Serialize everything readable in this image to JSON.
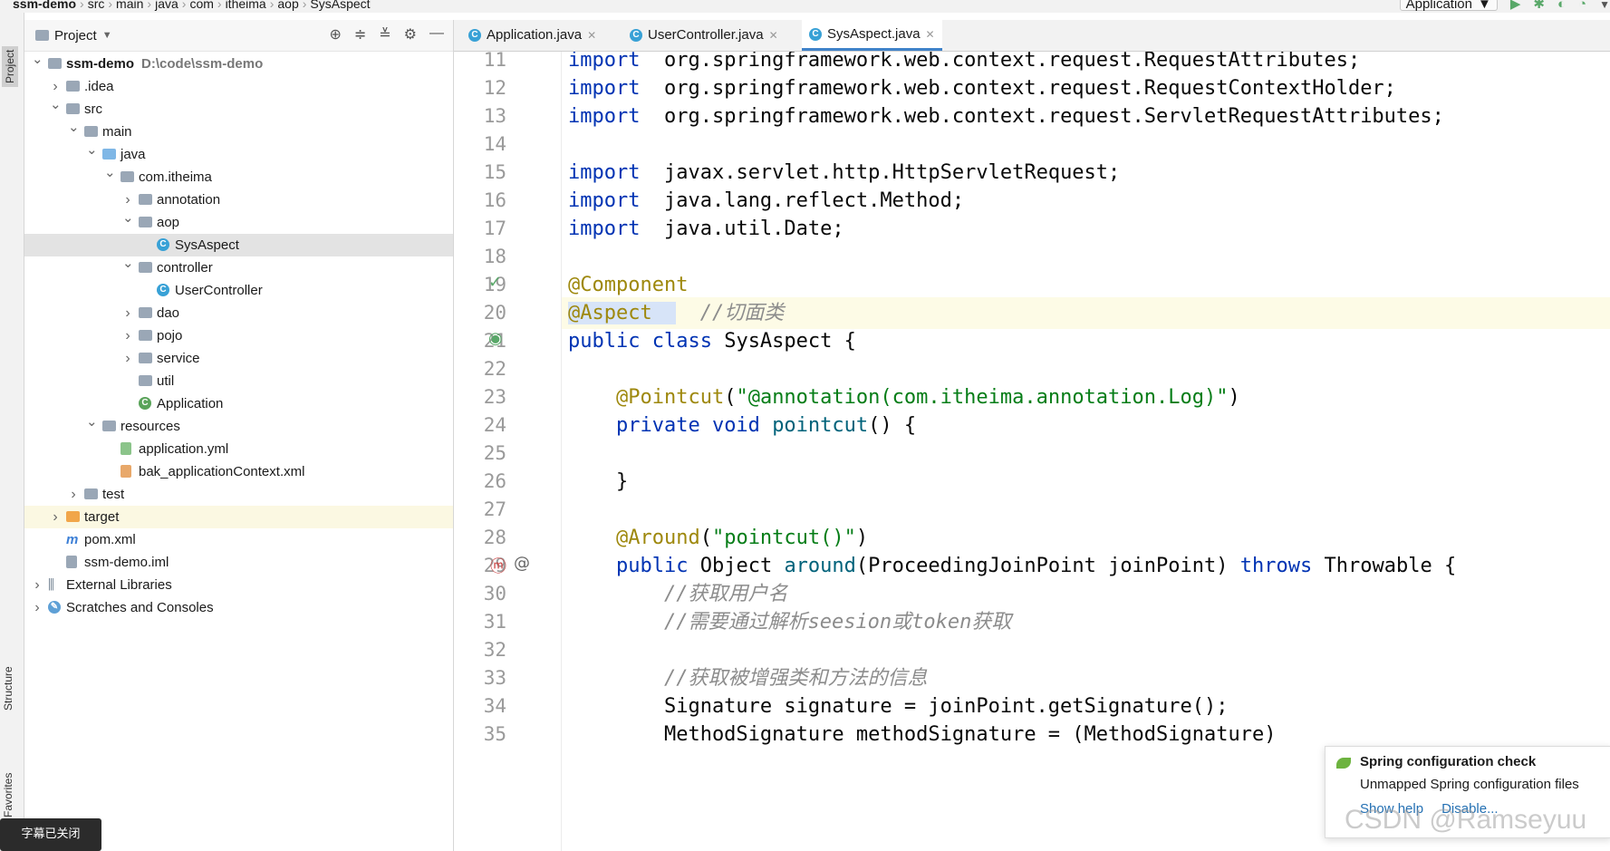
{
  "breadcrumb": [
    "ssm-demo",
    "src",
    "main",
    "java",
    "com",
    "itheima",
    "aop",
    "SysAspect"
  ],
  "run_config": {
    "label": "Application"
  },
  "left_strip": {
    "project": "Project",
    "structure": "Structure",
    "favorites": "Favorites"
  },
  "project_panel": {
    "title": "Project",
    "tree": [
      {
        "label": "ssm-demo",
        "path": "D:\\code\\ssm-demo",
        "depth": 0,
        "arrow": "open",
        "icon": "module"
      },
      {
        "label": ".idea",
        "depth": 1,
        "arrow": "closed",
        "icon": "folder"
      },
      {
        "label": "src",
        "depth": 1,
        "arrow": "open",
        "icon": "folder"
      },
      {
        "label": "main",
        "depth": 2,
        "arrow": "open",
        "icon": "folder"
      },
      {
        "label": "java",
        "depth": 3,
        "arrow": "open",
        "icon": "folder-blue"
      },
      {
        "label": "com.itheima",
        "depth": 4,
        "arrow": "open",
        "icon": "folder"
      },
      {
        "label": "annotation",
        "depth": 5,
        "arrow": "closed",
        "icon": "folder"
      },
      {
        "label": "aop",
        "depth": 5,
        "arrow": "open",
        "icon": "folder"
      },
      {
        "label": "SysAspect",
        "depth": 6,
        "arrow": "none",
        "icon": "class",
        "selected": true
      },
      {
        "label": "controller",
        "depth": 5,
        "arrow": "open",
        "icon": "folder"
      },
      {
        "label": "UserController",
        "depth": 6,
        "arrow": "none",
        "icon": "class"
      },
      {
        "label": "dao",
        "depth": 5,
        "arrow": "closed",
        "icon": "folder"
      },
      {
        "label": "pojo",
        "depth": 5,
        "arrow": "closed",
        "icon": "folder"
      },
      {
        "label": "service",
        "depth": 5,
        "arrow": "closed",
        "icon": "folder"
      },
      {
        "label": "util",
        "depth": 5,
        "arrow": "none",
        "icon": "folder"
      },
      {
        "label": "Application",
        "depth": 5,
        "arrow": "none",
        "icon": "spring-class"
      },
      {
        "label": "resources",
        "depth": 3,
        "arrow": "open",
        "icon": "folder-res"
      },
      {
        "label": "application.yml",
        "depth": 4,
        "arrow": "none",
        "icon": "yml"
      },
      {
        "label": "bak_applicationContext.xml",
        "depth": 4,
        "arrow": "none",
        "icon": "xml"
      },
      {
        "label": "test",
        "depth": 2,
        "arrow": "closed",
        "icon": "folder"
      },
      {
        "label": "target",
        "depth": 1,
        "arrow": "closed",
        "icon": "folder-orange",
        "highlight": true
      },
      {
        "label": "pom.xml",
        "depth": 1,
        "arrow": "none",
        "icon": "maven"
      },
      {
        "label": "ssm-demo.iml",
        "depth": 1,
        "arrow": "none",
        "icon": "iml"
      },
      {
        "label": "External Libraries",
        "depth": 0,
        "arrow": "closed",
        "icon": "libs"
      },
      {
        "label": "Scratches and Consoles",
        "depth": 0,
        "arrow": "closed",
        "icon": "scratch"
      }
    ]
  },
  "tabs": [
    {
      "label": "Application.java",
      "active": false
    },
    {
      "label": "UserController.java",
      "active": false
    },
    {
      "label": "SysAspect.java",
      "active": true
    }
  ],
  "code_lines": [
    {
      "n": "11",
      "segs": [
        [
          "kw",
          "import"
        ],
        [
          "",
          "  org.springframework.web.context.request.RequestAttributes;"
        ]
      ]
    },
    {
      "n": "12",
      "segs": [
        [
          "kw",
          "import"
        ],
        [
          "",
          "  org.springframework.web.context.request.RequestContextHolder;"
        ]
      ]
    },
    {
      "n": "13",
      "segs": [
        [
          "kw",
          "import"
        ],
        [
          "",
          "  org.springframework.web.context.request.ServletRequestAttributes;"
        ]
      ]
    },
    {
      "n": "14",
      "segs": []
    },
    {
      "n": "15",
      "segs": [
        [
          "kw",
          "import"
        ],
        [
          "",
          "  javax.servlet.http.HttpServletRequest;"
        ]
      ]
    },
    {
      "n": "16",
      "segs": [
        [
          "kw",
          "import"
        ],
        [
          "",
          "  java.lang.reflect.Method;"
        ]
      ]
    },
    {
      "n": "17",
      "segs": [
        [
          "kw",
          "import"
        ],
        [
          "",
          "  java.util.Date;"
        ]
      ]
    },
    {
      "n": "18",
      "segs": []
    },
    {
      "n": "19",
      "segs": [
        [
          "ann",
          "@Component"
        ]
      ]
    },
    {
      "n": "20",
      "segs": [
        [
          "sel-ann",
          "@Aspect  "
        ],
        [
          "",
          "  "
        ],
        [
          "cmt",
          "//切面类"
        ]
      ],
      "highlight": true
    },
    {
      "n": "21",
      "segs": [
        [
          "kw",
          "public class"
        ],
        [
          "",
          " SysAspect {"
        ]
      ]
    },
    {
      "n": "22",
      "segs": []
    },
    {
      "n": "23",
      "segs": [
        [
          "",
          "    "
        ],
        [
          "ann",
          "@Pointcut"
        ],
        [
          "",
          "("
        ],
        [
          "str",
          "\"@annotation(com.itheima.annotation.Log)\""
        ],
        [
          "",
          ")"
        ]
      ]
    },
    {
      "n": "24",
      "segs": [
        [
          "",
          "    "
        ],
        [
          "kw",
          "private void"
        ],
        [
          "",
          " "
        ],
        [
          "fn",
          "pointcut"
        ],
        [
          "",
          "() {"
        ]
      ]
    },
    {
      "n": "25",
      "segs": []
    },
    {
      "n": "26",
      "segs": [
        [
          "",
          "    }"
        ]
      ]
    },
    {
      "n": "27",
      "segs": []
    },
    {
      "n": "28",
      "segs": [
        [
          "",
          "    "
        ],
        [
          "ann",
          "@Around"
        ],
        [
          "",
          "("
        ],
        [
          "str",
          "\"pointcut()\""
        ],
        [
          "",
          ")"
        ]
      ]
    },
    {
      "n": "29",
      "segs": [
        [
          "",
          "    "
        ],
        [
          "kw",
          "public"
        ],
        [
          "",
          " Object "
        ],
        [
          "fn",
          "around"
        ],
        [
          "",
          "(ProceedingJoinPoint joinPoint) "
        ],
        [
          "kw",
          "throws"
        ],
        [
          "",
          " Throwable {"
        ]
      ]
    },
    {
      "n": "30",
      "segs": [
        [
          "",
          "        "
        ],
        [
          "cmt",
          "//获取用户名"
        ]
      ]
    },
    {
      "n": "31",
      "segs": [
        [
          "",
          "        "
        ],
        [
          "cmt",
          "//需要通过解析seesion或token获取"
        ]
      ]
    },
    {
      "n": "32",
      "segs": []
    },
    {
      "n": "33",
      "segs": [
        [
          "",
          "        "
        ],
        [
          "cmt",
          "//获取被增强类和方法的信息"
        ]
      ]
    },
    {
      "n": "34",
      "segs": [
        [
          "",
          "        Signature signature = joinPoint.getSignature();"
        ]
      ]
    },
    {
      "n": "35",
      "segs": [
        [
          "",
          "        MethodSignature methodSignature = (MethodSignature)"
        ]
      ]
    }
  ],
  "notification": {
    "title": "Spring configuration check",
    "body": "Unmapped Spring configuration files",
    "link_help": "Show help",
    "link_disable": "Disable..."
  },
  "watermark": "CSDN @Ramseyuu",
  "subtitle_badge": "字幕已关闭"
}
